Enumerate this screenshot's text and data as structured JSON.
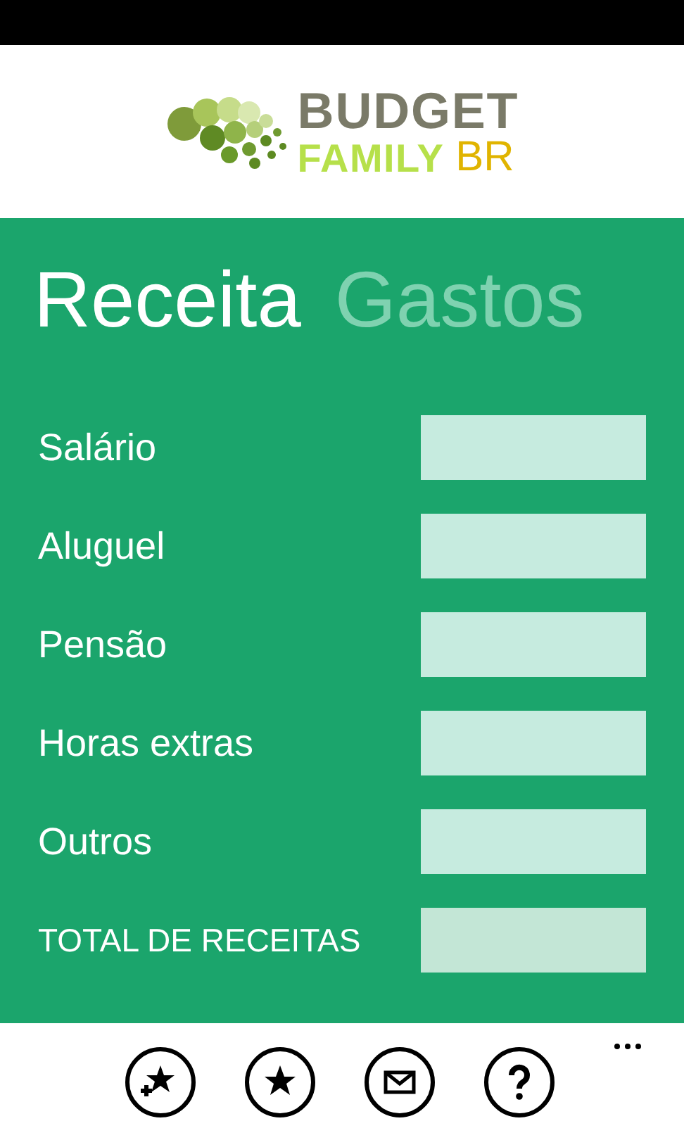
{
  "logo": {
    "line_1": "BUDGET",
    "line_2": "FAMILY",
    "badge": "BR"
  },
  "pivot": [
    {
      "label": "Receita",
      "selected": true
    },
    {
      "label": "Gastos",
      "selected": false
    }
  ],
  "fields": [
    {
      "label": "Salário",
      "kind": "input"
    },
    {
      "label": "Aluguel",
      "kind": "input"
    },
    {
      "label": "Pensão",
      "kind": "input"
    },
    {
      "label": "Horas extras",
      "kind": "input"
    },
    {
      "label": "Outros",
      "kind": "input"
    },
    {
      "label": "TOTAL DE RECEITAS",
      "kind": "total"
    }
  ],
  "app_bar": {
    "buttons": [
      {
        "kind": "add-favorite"
      },
      {
        "kind": "favorite"
      },
      {
        "kind": "mail"
      },
      {
        "kind": "help"
      }
    ]
  }
}
